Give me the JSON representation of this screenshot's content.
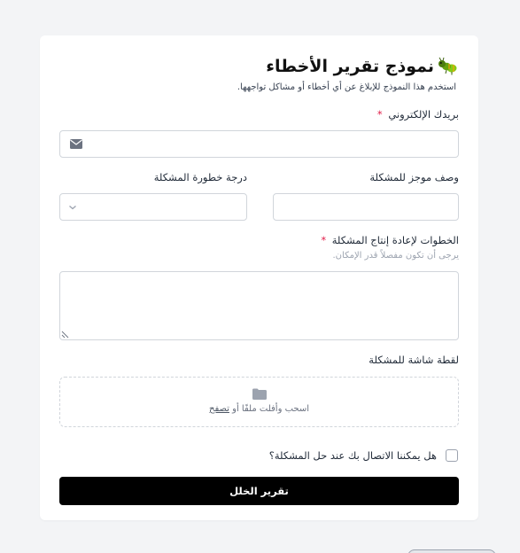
{
  "form": {
    "title": "نموذج تقرير الأخطاء",
    "title_icon": "bug-icon",
    "subtitle": "استخدم هذا النموذج للإبلاغ عن أي أخطاء أو مشاكل تواجهها.",
    "email": {
      "label": "بريدك الإلكتروني",
      "required_mark": "*",
      "value": "",
      "icon": "mail-icon"
    },
    "summary": {
      "label": "وصف موجز للمشكلة",
      "value": ""
    },
    "severity": {
      "label": "درجة خطورة المشكلة",
      "selected": "",
      "icon": "chevron-down-icon"
    },
    "steps": {
      "label": "الخطوات لإعادة إنتاج المشكلة",
      "required_mark": "*",
      "hint": "يرجى أن تكون مفصلاً قدر الإمكان.",
      "value": ""
    },
    "screenshot": {
      "label": "لقطة شاشة للمشكلة",
      "drop_text": "اسحب وأفلت ملفًا أو",
      "browse_text": "تصفح",
      "icon": "folder-icon"
    },
    "contact": {
      "label": "هل يمكننا الاتصال بك عند حل المشكلة؟",
      "checked": false
    },
    "submit_label": "تقرير الخلل"
  },
  "colors": {
    "background": "#f3f4f6",
    "card": "#ffffff",
    "button": "#000000",
    "required": "#e11d48"
  }
}
